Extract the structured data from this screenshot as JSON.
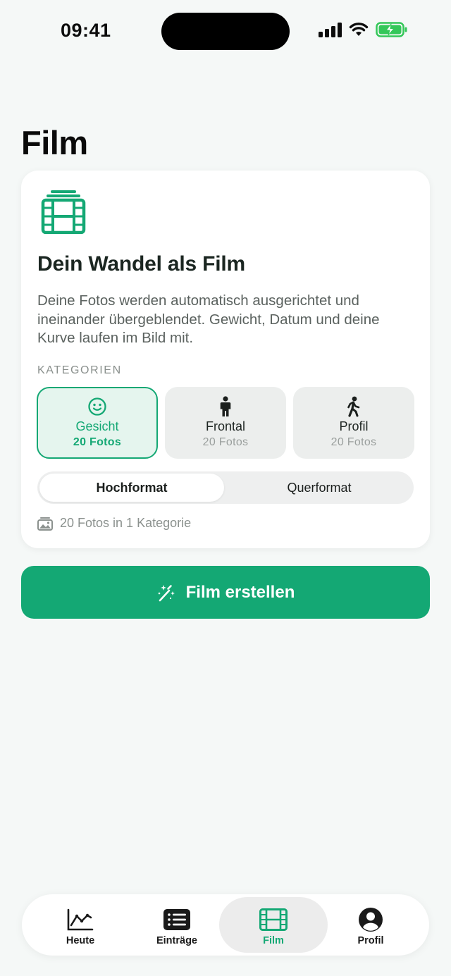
{
  "status_bar": {
    "time": "09:41"
  },
  "page": {
    "title": "Film"
  },
  "card": {
    "title": "Dein Wandel als Film",
    "description": "Deine Fotos werden automatisch ausgerichtet und ineinander übergeblendet. Gewicht, Datum und deine Kurve laufen im Bild mit.",
    "section_label": "KATEGORIEN",
    "categories": [
      {
        "name": "Gesicht",
        "count": "20 Fotos",
        "icon": "smiley-face-icon",
        "selected": true
      },
      {
        "name": "Frontal",
        "count": "20 Fotos",
        "icon": "standing-person-icon",
        "selected": false
      },
      {
        "name": "Profil",
        "count": "20 Fotos",
        "icon": "walking-person-icon",
        "selected": false
      }
    ],
    "format_options": [
      {
        "label": "Hochformat",
        "selected": true
      },
      {
        "label": "Querformat",
        "selected": false
      }
    ],
    "summary": "20 Fotos in 1 Kategorie",
    "summary_icon": "photo-stack-icon",
    "hero_icon": "film-stack-icon"
  },
  "cta": {
    "label": "Film erstellen",
    "icon": "magic-wand-icon"
  },
  "tabbar": {
    "tabs": [
      {
        "label": "Heute",
        "icon": "line-chart-icon",
        "active": false
      },
      {
        "label": "Einträge",
        "icon": "list-icon",
        "active": false
      },
      {
        "label": "Film",
        "icon": "film-icon",
        "active": true
      },
      {
        "label": "Profil",
        "icon": "person-circle-icon",
        "active": false
      }
    ]
  },
  "colors": {
    "accent": "#14a874",
    "background": "#f5f8f7",
    "card": "#ffffff"
  }
}
